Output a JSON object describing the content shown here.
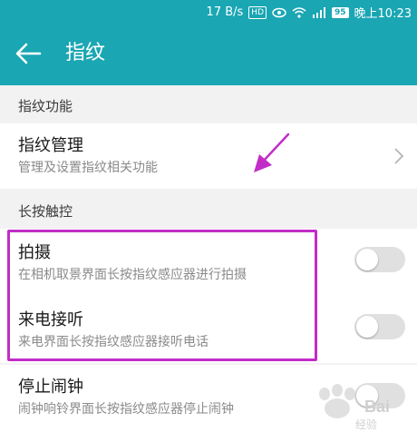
{
  "status_bar": {
    "speed": "17 B/s",
    "hd_label": "HD",
    "battery": "95",
    "time": "晚上10:23",
    "icons": [
      "hd-icon",
      "eye-icon",
      "wifi-icon",
      "signal-4g-icon",
      "battery-icon"
    ]
  },
  "app_bar": {
    "title": "指纹",
    "back_icon": "arrow-left-icon"
  },
  "sections": [
    {
      "header": "指纹功能"
    },
    {
      "header": "长按触控"
    }
  ],
  "items": {
    "manage": {
      "title": "指纹管理",
      "subtitle": "管理及设置指纹相关功能",
      "icon": "chevron-right-icon"
    },
    "shoot": {
      "title": "拍摄",
      "subtitle": "在相机取景界面长按指纹感应器进行拍摄",
      "toggle_on": false
    },
    "answer_call": {
      "title": "来电接听",
      "subtitle": "来电界面长按指纹感应器接听电话",
      "toggle_on": false
    },
    "stop_alarm": {
      "title": "停止闹钟",
      "subtitle": "闹钟响铃界面长按指纹感应器停止闹钟",
      "toggle_on": false
    }
  },
  "colors": {
    "primary": "#1aa6b3",
    "annotation": "#c22dc7",
    "toggle_off": "#e0e0e0"
  },
  "watermark": {
    "brand": "Baidu",
    "suffix": "经验"
  }
}
